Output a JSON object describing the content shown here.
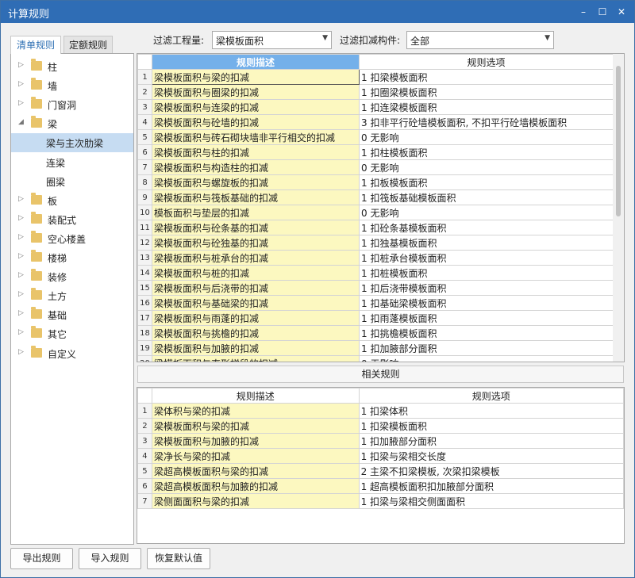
{
  "window": {
    "title": "计算规则",
    "minimize": "–",
    "maximize": "☐",
    "close": "✕"
  },
  "tabs": [
    {
      "label": "清单规则"
    },
    {
      "label": "定额规则"
    }
  ],
  "filters": {
    "project_label": "过滤工程量:",
    "project_value": "梁模板面积",
    "component_label": "过滤扣减构件:",
    "component_value": "全部"
  },
  "tree": [
    {
      "label": "柱",
      "expanded": false
    },
    {
      "label": "墙",
      "expanded": false
    },
    {
      "label": "门窗洞",
      "expanded": false
    },
    {
      "label": "梁",
      "expanded": true
    },
    {
      "label": "梁与主次肋梁",
      "child": true,
      "selected": true
    },
    {
      "label": "连梁",
      "child": true
    },
    {
      "label": "圈梁",
      "child": true
    },
    {
      "label": "板",
      "expanded": false
    },
    {
      "label": "装配式",
      "expanded": false
    },
    {
      "label": "空心楼盖",
      "expanded": false
    },
    {
      "label": "楼梯",
      "expanded": false
    },
    {
      "label": "装修",
      "expanded": false
    },
    {
      "label": "土方",
      "expanded": false
    },
    {
      "label": "基础",
      "expanded": false
    },
    {
      "label": "其它",
      "expanded": false
    },
    {
      "label": "自定义",
      "expanded": false
    }
  ],
  "main_table": {
    "headers": [
      "规则描述",
      "规则选项"
    ],
    "rows": [
      {
        "n": "1",
        "desc": "梁模板面积与梁的扣减",
        "opt": "1 扣梁模板面积"
      },
      {
        "n": "2",
        "desc": "梁模板面积与圈梁的扣减",
        "opt": "1 扣圈梁模板面积"
      },
      {
        "n": "3",
        "desc": "梁模板面积与连梁的扣减",
        "opt": "1 扣连梁模板面积"
      },
      {
        "n": "4",
        "desc": "梁模板面积与砼墙的扣减",
        "opt": "3 扣非平行砼墙模板面积, 不扣平行砼墙模板面积"
      },
      {
        "n": "5",
        "desc": "梁模板面积与砖石砌块墙非平行相交的扣减",
        "opt": "0  无影响"
      },
      {
        "n": "6",
        "desc": "梁模板面积与柱的扣减",
        "opt": "1 扣柱模板面积"
      },
      {
        "n": "7",
        "desc": "梁模板面积与构造柱的扣减",
        "opt": "0  无影响"
      },
      {
        "n": "8",
        "desc": "梁模板面积与螺旋板的扣减",
        "opt": "1 扣板模板面积"
      },
      {
        "n": "9",
        "desc": "梁模板面积与筏板基础的扣减",
        "opt": "1 扣筏板基础模板面积"
      },
      {
        "n": "10",
        "desc": "模板面积与垫层的扣减",
        "opt": "0  无影响"
      },
      {
        "n": "11",
        "desc": "梁模板面积与砼条基的扣减",
        "opt": "1 扣砼条基模板面积"
      },
      {
        "n": "12",
        "desc": "梁模板面积与砼独基的扣减",
        "opt": "1 扣独基模板面积"
      },
      {
        "n": "13",
        "desc": "梁模板面积与桩承台的扣减",
        "opt": "1 扣桩承台模板面积"
      },
      {
        "n": "14",
        "desc": "梁模板面积与桩的扣减",
        "opt": "1 扣桩模板面积"
      },
      {
        "n": "15",
        "desc": "梁模板面积与后浇带的扣减",
        "opt": "1 扣后浇带模板面积"
      },
      {
        "n": "16",
        "desc": "梁模板面积与基础梁的扣减",
        "opt": "1 扣基础梁模板面积"
      },
      {
        "n": "17",
        "desc": "梁模板面积与雨蓬的扣减",
        "opt": "1 扣雨蓬模板面积"
      },
      {
        "n": "18",
        "desc": "梁模板面积与挑檐的扣减",
        "opt": "1 扣挑檐模板面积"
      },
      {
        "n": "19",
        "desc": "梁模板面积与加腋的扣减",
        "opt": "1 扣加腋部分面积"
      },
      {
        "n": "20",
        "desc": "梁模板面积与直形梯段的扣减",
        "opt": "0  无影响"
      }
    ]
  },
  "related": {
    "title": "相关规则",
    "headers": [
      "规则描述",
      "规则选项"
    ],
    "rows": [
      {
        "n": "1",
        "desc": "梁体积与梁的扣减",
        "opt": "1 扣梁体积"
      },
      {
        "n": "2",
        "desc": "梁模板面积与梁的扣减",
        "opt": "1 扣梁模板面积"
      },
      {
        "n": "3",
        "desc": "梁模板面积与加腋的扣减",
        "opt": "1 扣加腋部分面积"
      },
      {
        "n": "4",
        "desc": "梁净长与梁的扣减",
        "opt": "1 扣梁与梁相交长度"
      },
      {
        "n": "5",
        "desc": "梁超高模板面积与梁的扣减",
        "opt": "2 主梁不扣梁模板, 次梁扣梁模板"
      },
      {
        "n": "6",
        "desc": "梁超高模板面积与加腋的扣减",
        "opt": "1 超高模板面积扣加腋部分面积"
      },
      {
        "n": "7",
        "desc": "梁侧面面积与梁的扣减",
        "opt": "1 扣梁与梁相交侧面面积"
      }
    ]
  },
  "buttons": {
    "export": "导出规则",
    "import": "导入规则",
    "restore": "恢复默认值"
  }
}
